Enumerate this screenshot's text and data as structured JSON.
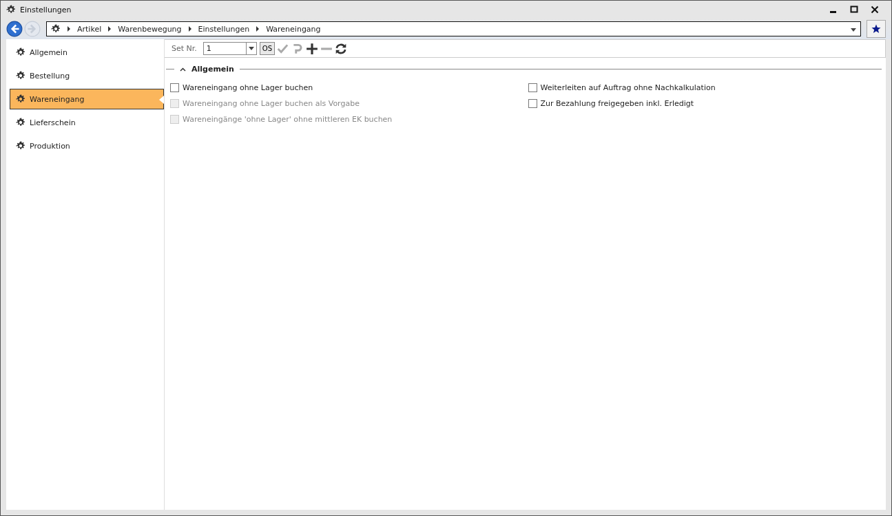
{
  "window": {
    "title": "Einstellungen"
  },
  "navigation": {
    "back_disabled": false,
    "forward_disabled": true,
    "breadcrumb": [
      "Artikel",
      "Warenbewegung",
      "Einstellungen",
      "Wareneingang"
    ]
  },
  "sidebar": {
    "items": [
      {
        "label": "Allgemein",
        "selected": false
      },
      {
        "label": "Bestellung",
        "selected": false
      },
      {
        "label": "Wareneingang",
        "selected": true
      },
      {
        "label": "Lieferschein",
        "selected": false
      },
      {
        "label": "Produktion",
        "selected": false
      }
    ]
  },
  "toolbar": {
    "set_label": "Set Nr.",
    "set_value": "1",
    "os_button": "OS",
    "tools": [
      {
        "kind": "check",
        "disabled": true
      },
      {
        "kind": "undo",
        "disabled": true
      },
      {
        "kind": "plus",
        "disabled": false
      },
      {
        "kind": "minus",
        "disabled": true
      },
      {
        "kind": "refresh",
        "disabled": false
      }
    ]
  },
  "section": {
    "title": "Allgemein",
    "expanded": true,
    "columns": [
      [
        {
          "label": "Wareneingang ohne Lager buchen",
          "checked": false,
          "disabled": false
        },
        {
          "label": "Wareneingang ohne Lager buchen als Vorgabe",
          "checked": false,
          "disabled": true
        },
        {
          "label": "Wareneingänge 'ohne Lager' ohne mittleren EK buchen",
          "checked": false,
          "disabled": true
        }
      ],
      [
        {
          "label": "Weiterleiten auf Auftrag ohne Nachkalkulation",
          "checked": false,
          "disabled": false
        },
        {
          "label": "Zur Bezahlung freigegeben inkl. Erledigt",
          "checked": false,
          "disabled": false
        }
      ]
    ]
  }
}
